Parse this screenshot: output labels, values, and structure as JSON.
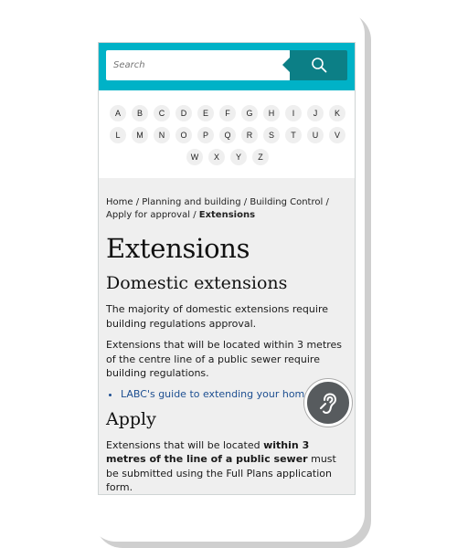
{
  "search": {
    "placeholder": "Search"
  },
  "az": {
    "row1": [
      "A",
      "B",
      "C",
      "D",
      "E",
      "F",
      "G",
      "H",
      "I",
      "J",
      "K"
    ],
    "row2": [
      "L",
      "M",
      "N",
      "O",
      "P",
      "Q",
      "R",
      "S",
      "T",
      "U",
      "V"
    ],
    "row3": [
      "W",
      "X",
      "Y",
      "Z"
    ]
  },
  "breadcrumb": {
    "home": "Home",
    "planning": "Planning and building",
    "building_control": "Building Control",
    "apply": "Apply for approval",
    "current": "Extensions",
    "sep": "/"
  },
  "page": {
    "title": "Extensions",
    "section1_heading": "Domestic extensions",
    "para1": "The majority of domestic extensions require building regulations approval.",
    "para2": "Extensions that will be located within 3 metres of the centre line of a public sewer require building regulations.",
    "link1": "LABC's guide to extending your home",
    "section2_heading": "Apply",
    "para3_start": "Extensions that will be located ",
    "para3_bold": "within 3 metres of the line of a public sewer",
    "para3_end": " must be submitted using the Full Plans application form."
  },
  "icons": {
    "search": "search-icon",
    "accessibility": "hearing-accessibility-icon"
  },
  "colors": {
    "teal": "#00b2c7",
    "dark_teal": "#0c7f86",
    "link": "#1d4f91"
  }
}
